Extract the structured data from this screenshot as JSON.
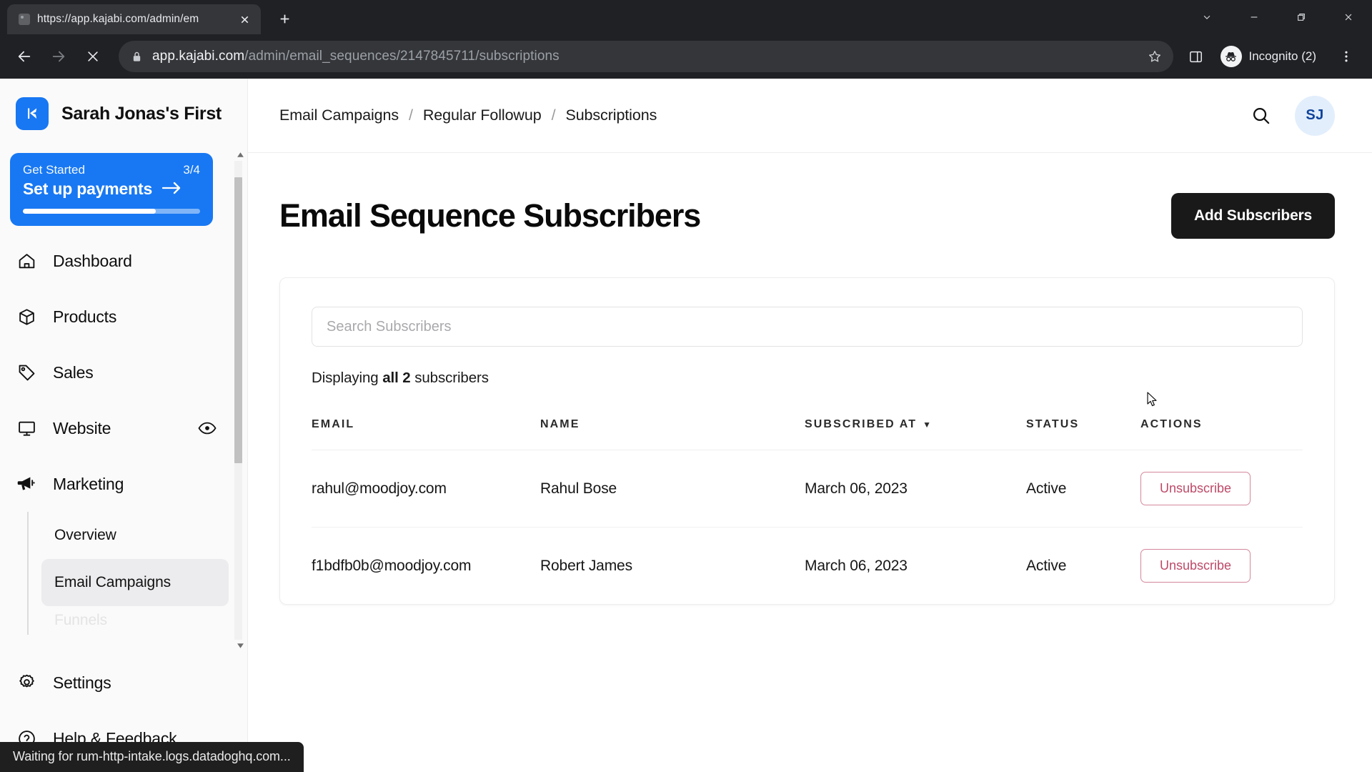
{
  "browser": {
    "tab": {
      "title": "https://app.kajabi.com/admin/em",
      "favicon": "globe-icon",
      "close_label": "×"
    },
    "new_tab_label": "+",
    "window_controls": [
      "tab-search-icon",
      "minimize-icon",
      "restore-icon",
      "close-icon"
    ],
    "nav": {
      "back": "back-arrow-icon",
      "forward": "forward-arrow-icon",
      "stop": "stop-loading-icon"
    },
    "omnibox": {
      "lock": "lock-icon",
      "url_host": "app.kajabi.com",
      "url_path": "/admin/email_sequences/2147845711/subscriptions",
      "star": "bookmark-star-icon"
    },
    "side_panel": "side-panel-icon",
    "profile": {
      "label": "Incognito (2)",
      "icon": "incognito-icon"
    },
    "menu": "three-dot-menu-icon",
    "status_text": "Waiting for rum-http-intake.logs.datadoghq.com..."
  },
  "sidebar": {
    "brand": {
      "name": "Sarah Jonas's First",
      "logo": "kajabi-logo"
    },
    "get_started": {
      "label": "Get Started",
      "count": "3/4",
      "action": "Set up payments",
      "arrow": "arrow-right-icon",
      "progress_percent": 75
    },
    "items": [
      {
        "label": "Dashboard",
        "icon": "home-icon"
      },
      {
        "label": "Products",
        "icon": "box-icon"
      },
      {
        "label": "Sales",
        "icon": "tag-icon"
      },
      {
        "label": "Website",
        "icon": "monitor-icon",
        "trailing_icon": "eye-icon"
      },
      {
        "label": "Marketing",
        "icon": "megaphone-icon",
        "expanded": true
      }
    ],
    "marketing_subitems": [
      {
        "label": "Overview",
        "active": false
      },
      {
        "label": "Email Campaigns",
        "active": true
      },
      {
        "label": "Funnels",
        "active": false,
        "faded": true
      }
    ],
    "bottom_items": [
      {
        "label": "Settings",
        "icon": "gear-icon"
      },
      {
        "label": "Help & Feedback",
        "icon": "question-circle-icon"
      }
    ]
  },
  "topbar": {
    "breadcrumb": [
      {
        "label": "Email Campaigns",
        "current": false
      },
      {
        "label": "Regular Followup",
        "current": false
      },
      {
        "label": "Subscriptions",
        "current": true
      }
    ],
    "separator": "/",
    "search_icon": "search-icon",
    "avatar_initials": "SJ"
  },
  "page": {
    "title": "Email Sequence Subscribers",
    "add_button": "Add Subscribers",
    "search_placeholder": "Search Subscribers",
    "search_value": "",
    "displaying_prefix": "Displaying",
    "displaying_strong": "all 2",
    "displaying_suffix": "subscribers"
  },
  "table": {
    "headers": {
      "email": "EMAIL",
      "name": "NAME",
      "subscribed_at": "SUBSCRIBED AT",
      "sort_arrow": "▼",
      "status": "STATUS",
      "actions": "ACTIONS"
    },
    "rows": [
      {
        "email": "rahul@moodjoy.com",
        "name": "Rahul Bose",
        "subscribed_at": "March 06, 2023",
        "status": "Active",
        "action_label": "Unsubscribe"
      },
      {
        "email": "f1bdfb0b@moodjoy.com",
        "name": "Robert James",
        "subscribed_at": "March 06, 2023",
        "status": "Active",
        "action_label": "Unsubscribe"
      }
    ]
  },
  "colors": {
    "accent_blue": "#1878f3",
    "avatar_bg": "#e2eefc",
    "avatar_fg": "#10439b",
    "danger": "#bd4a68",
    "dark_button": "#191919"
  }
}
